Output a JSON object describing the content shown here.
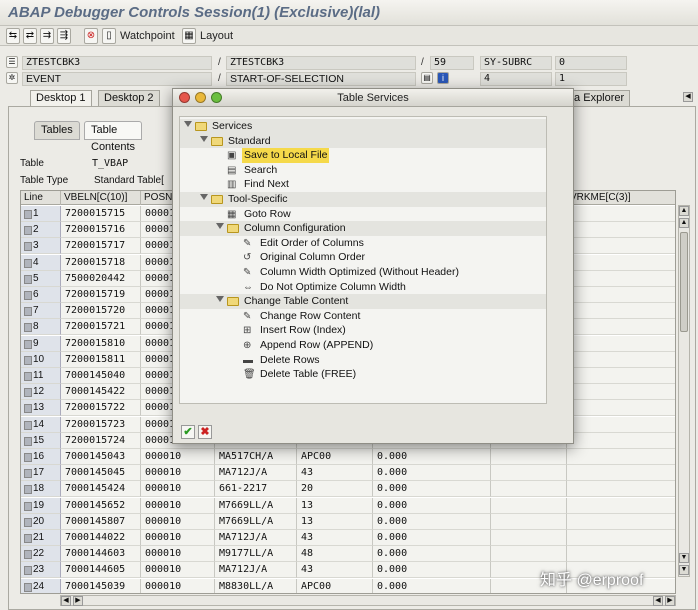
{
  "window": {
    "title": "ABAP Debugger Controls Session(1)  (Exclusive)(lal)"
  },
  "toolbar": {
    "watchpoint_label": "Watchpoint",
    "layout_label": "Layout"
  },
  "header": {
    "row1": {
      "program": "ZTESTCBK3",
      "include": "ZTESTCBK3",
      "line": "59",
      "sysubrc_label": "SY-SUBRC",
      "sysubrc_value": "0"
    },
    "row2": {
      "event_label": "EVENT",
      "event": "START-OF-SELECTION",
      "tabix": "4",
      "value": "1"
    }
  },
  "desktop_tabs": [
    "Desktop 1",
    "Desktop 2",
    "ta Explorer"
  ],
  "sub_tabs": [
    "Tables",
    "Table Contents"
  ],
  "table_info": {
    "table_label": "Table",
    "table_value": "T_VBAP",
    "type_label": "Table Type",
    "type_value": "Standard Table["
  },
  "grid": {
    "columns": [
      "Line",
      "VBELN[C(10)]",
      "POSN",
      "",
      "",
      "",
      "",
      "VRKME[C(3)]"
    ],
    "rows": [
      [
        "1",
        "7200015715",
        "00001",
        "",
        "",
        "",
        ""
      ],
      [
        "2",
        "7200015716",
        "00001",
        "",
        "",
        "",
        ""
      ],
      [
        "3",
        "7200015717",
        "00001",
        "",
        "",
        "",
        ""
      ],
      [
        "4",
        "7200015718",
        "00001",
        "",
        "",
        "",
        ""
      ],
      [
        "5",
        "7500020442",
        "00001",
        "",
        "",
        "",
        ""
      ],
      [
        "6",
        "7200015719",
        "00001",
        "",
        "",
        "",
        ""
      ],
      [
        "7",
        "7200015720",
        "00001",
        "",
        "",
        "",
        ""
      ],
      [
        "8",
        "7200015721",
        "00001",
        "",
        "",
        "",
        ""
      ],
      [
        "9",
        "7200015810",
        "00001",
        "",
        "",
        "",
        ""
      ],
      [
        "10",
        "7200015811",
        "00001",
        "",
        "",
        "",
        ""
      ],
      [
        "11",
        "7000145040",
        "00001",
        "",
        "",
        "",
        ""
      ],
      [
        "12",
        "7000145422",
        "00001",
        "",
        "",
        "",
        ""
      ],
      [
        "13",
        "7200015722",
        "00001",
        "",
        "",
        "",
        ""
      ],
      [
        "14",
        "7200015723",
        "00001",
        "",
        "",
        "",
        ""
      ],
      [
        "15",
        "7200015724",
        "00001",
        "",
        "",
        "",
        ""
      ],
      [
        "16",
        "7000145043",
        "000010",
        "MA517CH/A",
        "APC00",
        "0.000",
        ""
      ],
      [
        "17",
        "7000145045",
        "000010",
        "MA712J/A",
        "43",
        "0.000",
        ""
      ],
      [
        "18",
        "7000145424",
        "000010",
        "661-2217",
        "20",
        "0.000",
        ""
      ],
      [
        "19",
        "7000145652",
        "000010",
        "M7669LL/A",
        "13",
        "0.000",
        ""
      ],
      [
        "20",
        "7000145807",
        "000010",
        "M7669LL/A",
        "13",
        "0.000",
        ""
      ],
      [
        "21",
        "7000144022",
        "000010",
        "MA712J/A",
        "43",
        "0.000",
        ""
      ],
      [
        "22",
        "7000144603",
        "000010",
        "M9177LL/A",
        "48",
        "0.000",
        ""
      ],
      [
        "23",
        "7000144605",
        "000010",
        "MA712J/A",
        "43",
        "0.000",
        ""
      ],
      [
        "24",
        "7000145039",
        "000010",
        "M8830LL/A",
        "APC00",
        "0.000",
        ""
      ]
    ]
  },
  "dialog": {
    "title": "Table Services",
    "tree": [
      {
        "label": "Services",
        "kind": "folder",
        "icon": "folder-icon"
      },
      {
        "label": "Standard",
        "kind": "folder",
        "icon": "folder-icon"
      },
      {
        "label": "Save to Local File",
        "kind": "item",
        "icon": "save-icon",
        "selected": true
      },
      {
        "label": "Search",
        "kind": "item",
        "icon": "search-icon"
      },
      {
        "label": "Find Next",
        "kind": "item",
        "icon": "find-next-icon"
      },
      {
        "label": "Tool-Specific",
        "kind": "folder",
        "icon": "folder-icon"
      },
      {
        "label": "Goto Row",
        "kind": "item",
        "icon": "goto-row-icon"
      },
      {
        "label": "Column Configuration",
        "kind": "folder",
        "icon": "folder-icon"
      },
      {
        "label": "Edit Order of Columns",
        "kind": "item",
        "icon": "pencil-icon"
      },
      {
        "label": "Original Column Order",
        "kind": "item",
        "icon": "original-order-icon"
      },
      {
        "label": "Column Width Optimized (Without Header)",
        "kind": "item",
        "icon": "pencil-icon"
      },
      {
        "label": "Do Not Optimize Column Width",
        "kind": "item",
        "icon": "no-optimize-icon"
      },
      {
        "label": "Change Table Content",
        "kind": "folder",
        "icon": "folder-icon"
      },
      {
        "label": "Change Row Content",
        "kind": "item",
        "icon": "pencil-icon"
      },
      {
        "label": "Insert Row (Index)",
        "kind": "item",
        "icon": "insert-row-icon"
      },
      {
        "label": "Append Row (APPEND)",
        "kind": "item",
        "icon": "append-row-icon"
      },
      {
        "label": "Delete Rows",
        "kind": "item",
        "icon": "delete-rows-icon"
      },
      {
        "label": "Delete Table (FREE)",
        "kind": "item",
        "icon": "trash-icon"
      }
    ],
    "confirm_icon": "check-icon",
    "cancel_icon": "cancel-icon"
  },
  "watermark": "知乎 @erproof",
  "colors": {
    "title": "#5b6c85",
    "selection": "#f5d94a",
    "folder": "#f0d879"
  }
}
